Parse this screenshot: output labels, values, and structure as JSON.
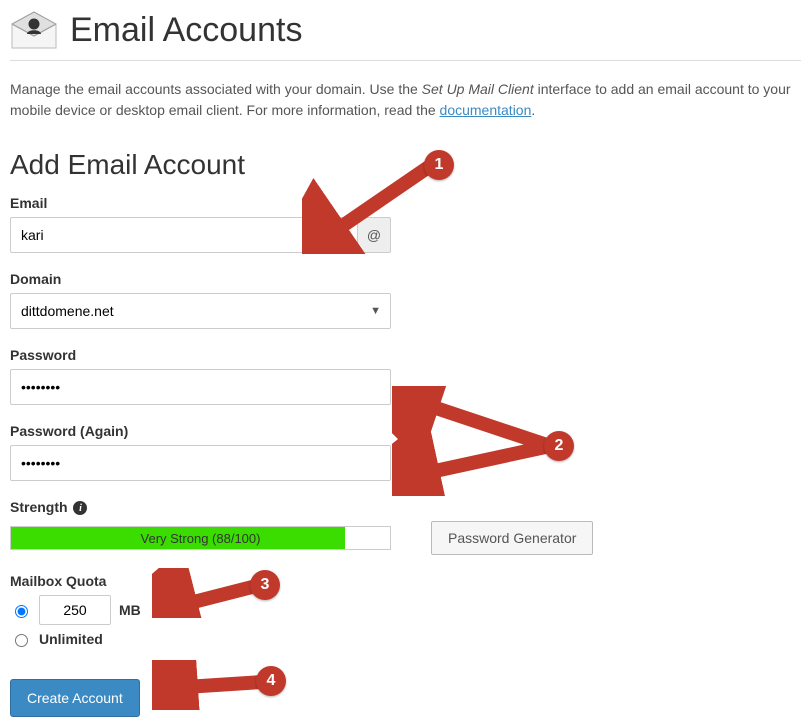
{
  "header": {
    "title": "Email Accounts"
  },
  "intro": {
    "text_before": "Manage the email accounts associated with your domain. Use the ",
    "em": "Set Up Mail Client",
    "text_after_em": " interface to add an email account to your mobile device or desktop email client. For more information, read the ",
    "link": "documentation",
    "period": "."
  },
  "form": {
    "section_title": "Add Email Account",
    "email_label": "Email",
    "email_value": "kari",
    "at_symbol": "@",
    "domain_label": "Domain",
    "domain_value": "dittdomene.net",
    "password_label": "Password",
    "password_value": "••••••••",
    "password2_label": "Password (Again)",
    "password2_value": "••••••••",
    "strength_label": "Strength",
    "strength_text": "Very Strong (88/100)",
    "strength_percent": 88,
    "gen_btn": "Password Generator",
    "quota_label": "Mailbox Quota",
    "quota_value": "250",
    "quota_unit": "MB",
    "unlimited_label": "Unlimited",
    "create_btn": "Create Account"
  },
  "annotations": {
    "a1": "1",
    "a2": "2",
    "a3": "3",
    "a4": "4"
  }
}
